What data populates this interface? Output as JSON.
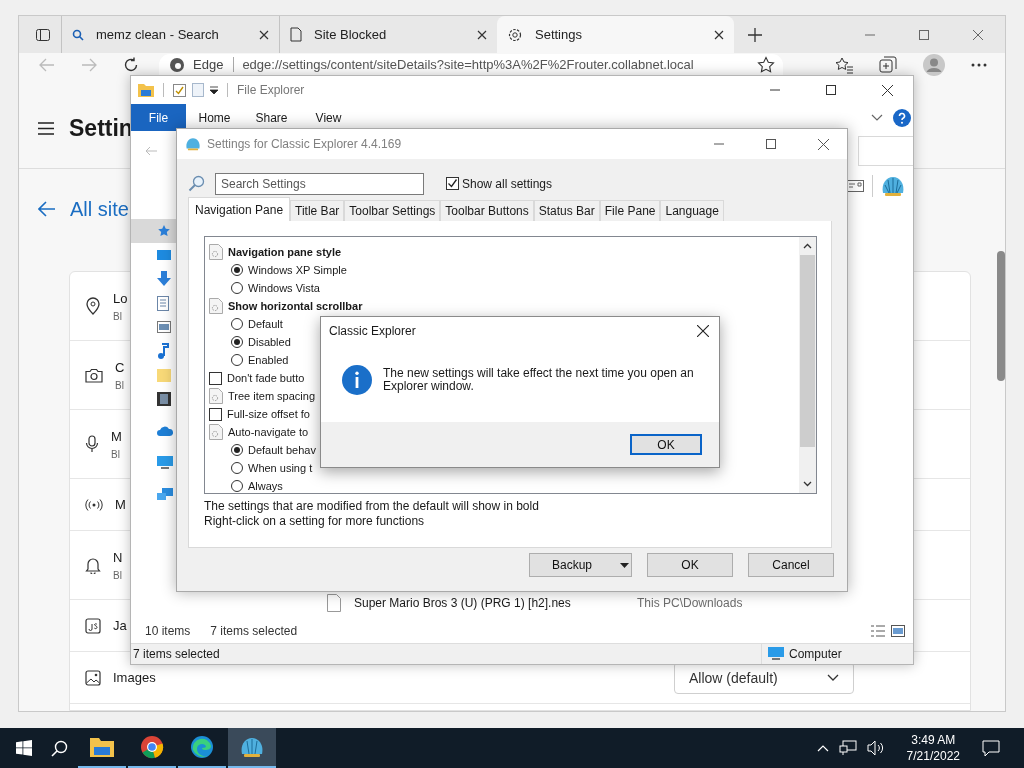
{
  "edge": {
    "tabs": [
      {
        "label": "memz clean - Search",
        "selected": false
      },
      {
        "label": "Site Blocked",
        "selected": false
      },
      {
        "label": "Settings",
        "selected": true
      }
    ],
    "address": {
      "chip": "Edge",
      "url": "edge://settings/content/siteDetails?site=http%3A%2F%2Frouter.collabnet.local"
    },
    "page_title": "Settin",
    "back_label": "All site",
    "rows": [
      {
        "title": "Lo",
        "subtitle": "Bl"
      },
      {
        "title": "C",
        "subtitle": "Bl"
      },
      {
        "title": "M",
        "subtitle": "Bl"
      },
      {
        "title": "M"
      },
      {
        "title": "N",
        "subtitle": "Bl"
      },
      {
        "title": "Ja"
      },
      {
        "title": "Images",
        "dropdown": "Allow (default)"
      }
    ]
  },
  "file_explorer": {
    "title": "File Explorer",
    "file_menu": "File",
    "ribbon_tabs": [
      "Home",
      "Share",
      "View"
    ],
    "nav_pane": [
      {
        "selected": true
      },
      {
        "selected": false
      },
      {
        "selected": false
      },
      {
        "selected": false
      },
      {
        "selected": false
      },
      {
        "selected": false
      },
      {
        "selected": false
      },
      {
        "selected": false
      },
      {
        "selected": false
      },
      {
        "selected": false
      },
      {
        "selected": false
      }
    ],
    "file": {
      "name": "Super Mario Bros 3 (U) (PRG 1) [h2].nes",
      "location": "This PC\\Downloads"
    },
    "item_count": "10 items",
    "selection_count": "7 items selected",
    "status_bar": {
      "left": "7 items selected",
      "right": "Computer"
    }
  },
  "classic_settings": {
    "title": "Settings for Classic Explorer 4.4.169",
    "search": {
      "placeholder": "Search Settings"
    },
    "show_all": {
      "label": "Show all settings",
      "checked": true
    },
    "tabs": [
      {
        "label": "Navigation Pane",
        "selected": true
      },
      {
        "label": "Title Bar",
        "selected": false
      },
      {
        "label": "Toolbar Settings",
        "selected": false
      },
      {
        "label": "Toolbar Buttons",
        "selected": false
      },
      {
        "label": "Status Bar",
        "selected": false
      },
      {
        "label": "File Pane",
        "selected": false
      },
      {
        "label": "Language",
        "selected": false
      }
    ],
    "settings": [
      {
        "kind": "group",
        "label": "Navigation pane style",
        "modified": true,
        "children": [
          {
            "label": "Windows XP Simple",
            "selected": true
          },
          {
            "label": "Windows Vista",
            "selected": false
          }
        ]
      },
      {
        "kind": "group",
        "label": "Show horizontal scrollbar",
        "modified": true,
        "children": [
          {
            "label": "Default",
            "selected": false
          },
          {
            "label": "Disabled",
            "selected": true
          },
          {
            "label": "Enabled",
            "selected": false
          }
        ]
      },
      {
        "kind": "checkbox",
        "label": "Don't fade butto",
        "checked": false
      },
      {
        "kind": "group",
        "label": "Tree item spacing",
        "modified": false
      },
      {
        "kind": "checkbox",
        "label": "Full-size offset fo",
        "checked": false
      },
      {
        "kind": "group",
        "label": "Auto-navigate to",
        "modified": false,
        "children": [
          {
            "label": "Default behav",
            "selected": true
          },
          {
            "label": "When using t",
            "selected": false
          },
          {
            "label": "Always",
            "selected": false
          }
        ]
      }
    ],
    "notes": [
      "The settings that are modified from the default will show in bold",
      "Right-click on a setting for more functions"
    ],
    "buttons": [
      {
        "label": "Backup",
        "kind": "split"
      },
      {
        "label": "OK",
        "kind": "plain"
      },
      {
        "label": "Cancel",
        "kind": "plain"
      }
    ]
  },
  "dialog": {
    "title": "Classic Explorer",
    "message": "The new settings will take effect the next time you open an Explorer window.",
    "button": "OK"
  },
  "taskbar": {
    "apps": [
      {
        "running": true,
        "selected": false
      },
      {
        "running": true,
        "selected": false
      },
      {
        "running": true,
        "selected": false
      },
      {
        "running": true,
        "selected": true
      }
    ],
    "time": "3:49 AM",
    "date": "7/21/2022"
  }
}
